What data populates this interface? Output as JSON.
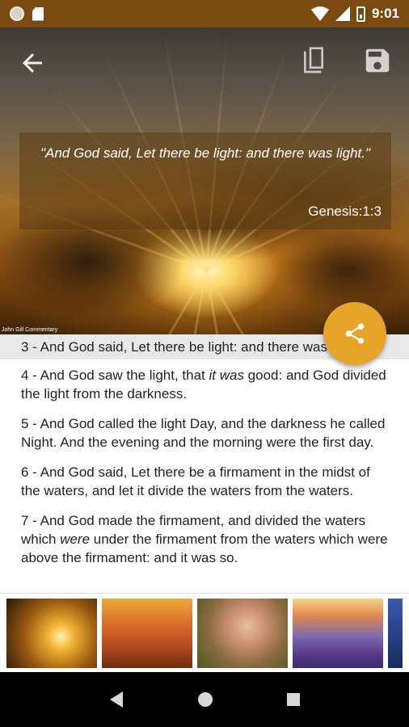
{
  "status_bar": {
    "time": "9:01",
    "icons": [
      "circle-icon",
      "sd-card-icon",
      "wifi-icon",
      "signal-icon",
      "battery-icon"
    ]
  },
  "toolbar": {
    "back_icon": "arrow-left-icon",
    "copy_icon": "copy-icon",
    "save_icon": "save-icon"
  },
  "hero": {
    "quote": "\"And God said, Let there be light: and there was light.\"",
    "reference": "Genesis:1:3",
    "watermark": "John Gill Commentary"
  },
  "share_button": {
    "icon": "share-icon",
    "color": "#e8a329"
  },
  "verses": [
    {
      "number": "3",
      "text": "3 - And God said, Let there be light: and there was light.",
      "selected": true
    },
    {
      "number": "4",
      "parts": [
        "4 - And God saw the light, that ",
        "it was",
        " good: and God divided the light from the darkness."
      ]
    },
    {
      "number": "5",
      "text": "5 - And God called the light Day, and the darkness he called Night. And the evening and the morning were the first day."
    },
    {
      "number": "6",
      "text": "6 - And God said, Let there be a firmament in the midst of the waters, and let it divide the waters from the waters."
    },
    {
      "number": "7",
      "parts": [
        "7 - And God made the firmament, and divided the waters which ",
        "were",
        " under the firmament from the waters which were above the firmament: and it was so."
      ]
    }
  ],
  "thumbnails": [
    "sunset-clouds",
    "autumn-forest",
    "wildflowers",
    "lavender-field",
    "blue-sky"
  ],
  "nav_bar": {
    "icons": [
      "back-triangle-icon",
      "home-circle-icon",
      "recents-square-icon"
    ]
  },
  "colors": {
    "status_bar": "#7a4a10",
    "accent": "#e8a329",
    "selected_row": "#e8e8e8"
  }
}
